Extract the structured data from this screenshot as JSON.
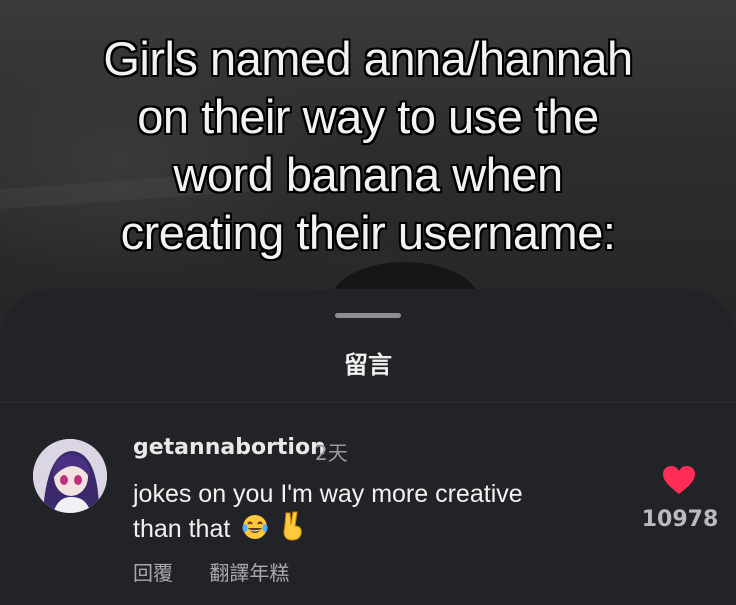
{
  "video": {
    "caption_lines": [
      "Girls named anna/hannah",
      "on their way to use the",
      "word banana when",
      "creating their username:"
    ]
  },
  "comments_sheet": {
    "title": "留言"
  },
  "comment": {
    "username": "getannabortion",
    "time": "2天",
    "text_line1": "jokes on you I'm way more creative",
    "text_line2": "than that",
    "emojis": [
      "laughing-tears-emoji",
      "victory-hand-emoji"
    ],
    "reply_label": "回覆",
    "translate_label": "翻譯年糕",
    "like_count": "10978",
    "like_icon": "heart-icon",
    "like_color": "#ff2d55"
  },
  "colors": {
    "sheet_background": "#212326",
    "caption_text": "#f2f2f2",
    "secondary_text": "#9a9ca1"
  }
}
